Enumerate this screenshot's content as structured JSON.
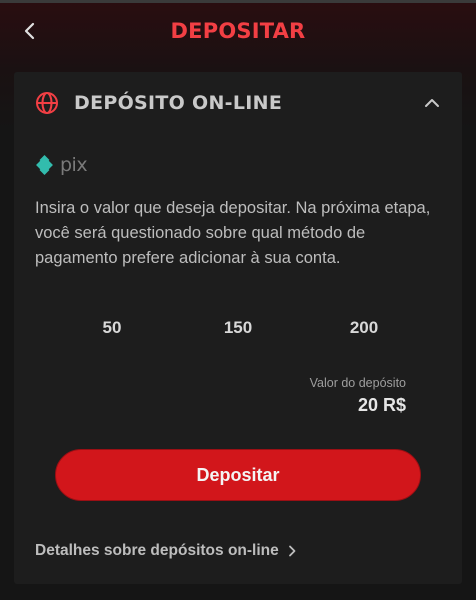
{
  "header": {
    "title": "DEPOSITAR",
    "back_icon": "chevron-left-icon"
  },
  "section": {
    "title": "DEPÓSITO ON-LINE",
    "icon": "globe-icon",
    "toggle_icon": "chevron-up-icon",
    "expanded": true
  },
  "payment_method": {
    "logo_text": "pix",
    "logo_color": "#32bcad"
  },
  "description": "Insira o valor que deseja depositar. Na próxima etapa, você será questionado sobre qual método de pagamento prefere adicionar à sua conta.",
  "quick_amounts": [
    "50",
    "150",
    "200"
  ],
  "deposit": {
    "label": "Valor do depósito",
    "value": "20 R$"
  },
  "submit_button": "Depositar",
  "details_link": "Detalhes sobre depósitos on-line",
  "colors": {
    "accent": "#f23f44",
    "button": "#d2161b",
    "card": "#1d1d1d"
  }
}
